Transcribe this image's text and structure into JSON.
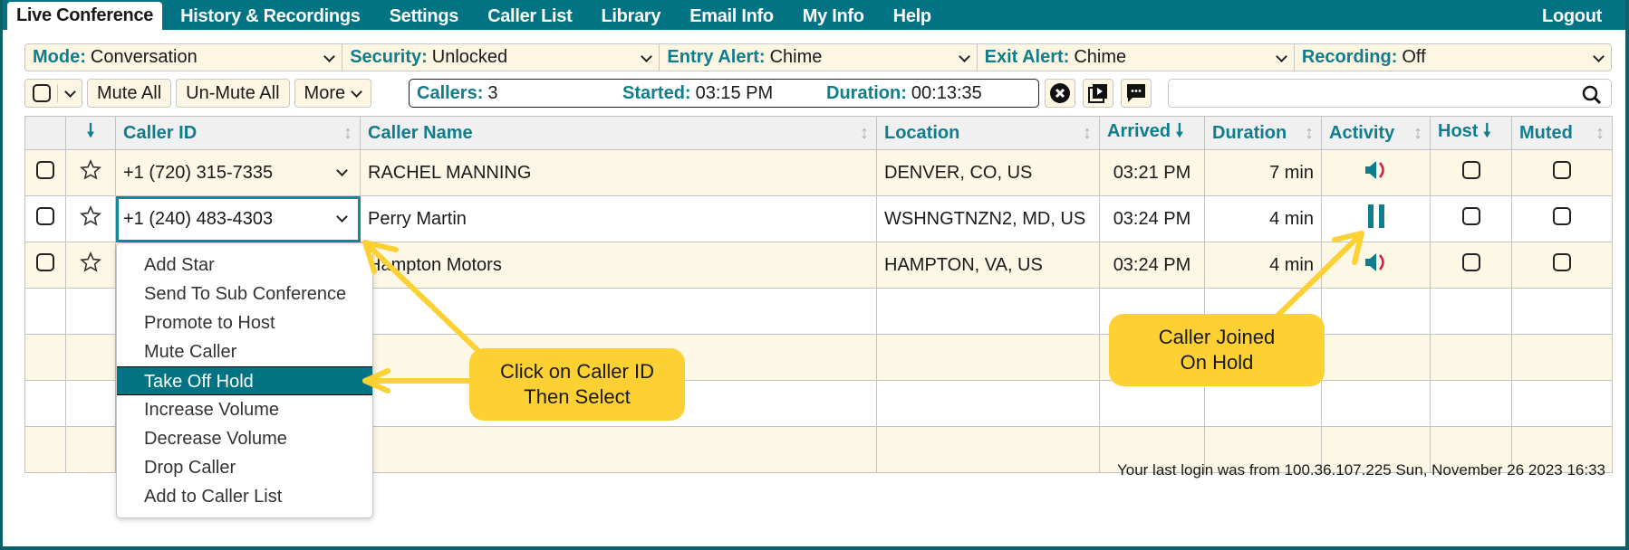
{
  "nav": {
    "tabs": [
      {
        "label": "Live Conference",
        "active": true
      },
      {
        "label": "History & Recordings"
      },
      {
        "label": "Settings"
      },
      {
        "label": "Caller List"
      },
      {
        "label": "Library"
      },
      {
        "label": "Email Info"
      },
      {
        "label": "My Info"
      },
      {
        "label": "Help"
      }
    ],
    "logout": "Logout"
  },
  "filters": [
    {
      "label": "Mode:",
      "value": "Conversation"
    },
    {
      "label": "Security:",
      "value": "Unlocked"
    },
    {
      "label": "Entry Alert:",
      "value": "Chime"
    },
    {
      "label": "Exit Alert:",
      "value": "Chime"
    },
    {
      "label": "Recording:",
      "value": "Off"
    }
  ],
  "toolbar": {
    "mute_all": "Mute All",
    "unmute_all": "Un-Mute All",
    "more": "More"
  },
  "status": {
    "callers_label": "Callers:",
    "callers": "3",
    "started_label": "Started:",
    "started": "03:15 PM",
    "duration_label": "Duration:",
    "duration": "00:13:35"
  },
  "search": {
    "value": "",
    "placeholder": ""
  },
  "table": {
    "headers": [
      "Caller ID",
      "Caller Name",
      "Location",
      "Arrived",
      "Duration",
      "Activity",
      "Host",
      "Muted"
    ],
    "rows": [
      {
        "caller_id": "+1 (720) 315-7335",
        "name": "RACHEL MANNING",
        "location": "DENVER, CO, US",
        "arrived": "03:21 PM",
        "duration": "7 min",
        "activity": "speaking",
        "host": false,
        "muted": false
      },
      {
        "caller_id": "+1 (240) 483-4303",
        "name": "Perry Martin",
        "location": "WSHNGTNZN2, MD, US",
        "arrived": "03:24 PM",
        "duration": "4 min",
        "activity": "on-hold",
        "host": false,
        "muted": false
      },
      {
        "caller_id": "",
        "name": "Hampton Motors",
        "location": "HAMPTON, VA, US",
        "arrived": "03:24 PM",
        "duration": "4 min",
        "activity": "speaking",
        "host": false,
        "muted": false
      }
    ]
  },
  "context_menu": {
    "items": [
      "Add Star",
      "Send To Sub Conference",
      "Promote to Host",
      "Mute Caller",
      "Take Off Hold",
      "Increase Volume",
      "Decrease Volume",
      "Drop Caller",
      "Add to Caller List"
    ],
    "selected": "Take Off Hold"
  },
  "callouts": {
    "left": [
      "Click on Caller ID",
      "Then Select"
    ],
    "right": [
      "Caller Joined",
      "On Hold"
    ]
  },
  "footer": "Your last login was from 100.36.107.225 Sun, November 26 2023 16:33",
  "colors": {
    "brand": "#027383",
    "accent_text": "#0f7d8c",
    "callout": "#fdd033",
    "row_alt": "#fdf7e6"
  }
}
